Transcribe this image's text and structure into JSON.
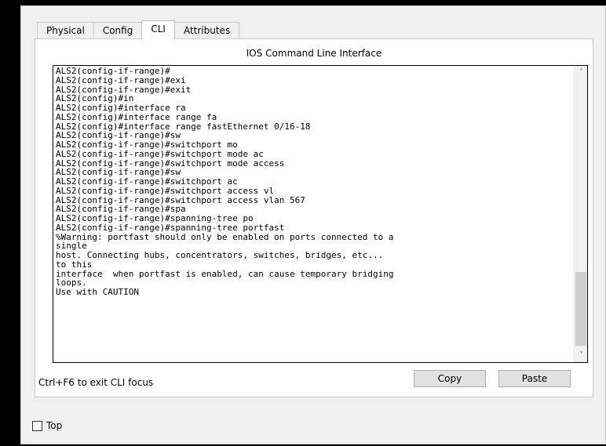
{
  "tabs": [
    {
      "label": "Physical",
      "active": false
    },
    {
      "label": "Config",
      "active": false
    },
    {
      "label": "CLI",
      "active": true
    },
    {
      "label": "Attributes",
      "active": false
    }
  ],
  "panel_title": "IOS Command Line Interface",
  "terminal_lines": [
    "ALS2(config-if-range)#",
    "ALS2(config-if-range)#exi",
    "ALS2(config-if-range)#exit",
    "ALS2(config)#in",
    "ALS2(config)#interface ra",
    "ALS2(config)#interface range fa",
    "ALS2(config)#interface range fastEthernet 0/16-18",
    "ALS2(config-if-range)#sw",
    "ALS2(config-if-range)#switchport mo",
    "ALS2(config-if-range)#switchport mode ac",
    "ALS2(config-if-range)#switchport mode access",
    "ALS2(config-if-range)#sw",
    "ALS2(config-if-range)#switchport ac",
    "ALS2(config-if-range)#switchport access vl",
    "ALS2(config-if-range)#switchport access vlan 567",
    "ALS2(config-if-range)#spa",
    "ALS2(config-if-range)#spanning-tree po",
    "ALS2(config-if-range)#spanning-tree portfast",
    "%Warning: portfast should only be enabled on ports connected to a",
    "single",
    "host. Connecting hubs, concentrators, switches, bridges, etc...",
    "to this",
    "interface  when portfast is enabled, can cause temporary bridging",
    "loops.",
    "Use with CAUTION"
  ],
  "focus_hint": "Ctrl+F6 to exit CLI focus",
  "buttons": {
    "copy": "Copy",
    "paste": "Paste"
  },
  "top_checkbox": {
    "label": "Top",
    "checked": false
  },
  "icons": {
    "scroll_up": "chevron-up-icon",
    "scroll_down": "chevron-down-icon"
  }
}
